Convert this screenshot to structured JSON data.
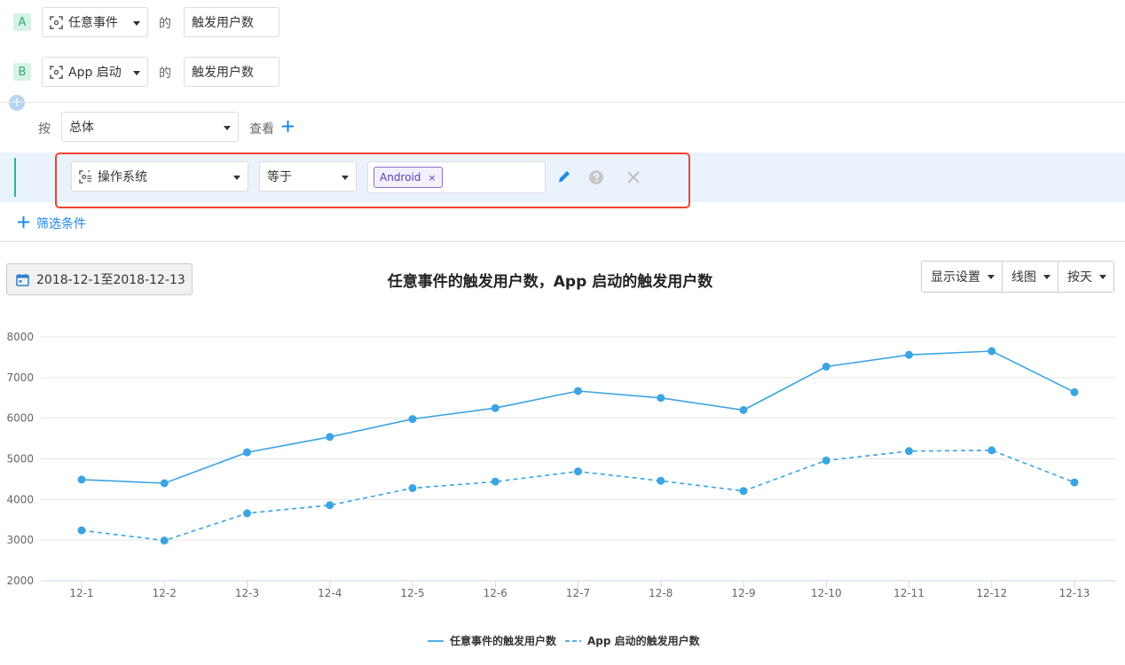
{
  "metrics": [
    {
      "badge": "A",
      "event": "任意事件",
      "of": "的",
      "measure": "触发用户数"
    },
    {
      "badge": "B",
      "event": "App 启动",
      "of": "的",
      "measure": "触发用户数"
    }
  ],
  "groupby": {
    "prefix": "按",
    "value": "总体",
    "suffix": "查看"
  },
  "filter": {
    "property": "操作系统",
    "operator": "等于",
    "value_tag": "Android",
    "tag_close": "×"
  },
  "add_filter_label": "筛选条件",
  "date_range": "2018-12-1至2018-12-13",
  "chart_title": "任意事件的触发用户数，App 启动的触发用户数",
  "toolbar": {
    "display_settings": "显示设置",
    "chart_type": "线图",
    "granularity": "按天"
  },
  "chart_data": {
    "type": "line",
    "categories": [
      "12-1",
      "12-2",
      "12-3",
      "12-4",
      "12-5",
      "12-6",
      "12-7",
      "12-8",
      "12-9",
      "12-10",
      "12-11",
      "12-12",
      "12-13"
    ],
    "ylim": [
      2000,
      8000
    ],
    "yticks": [
      "2000",
      "3000",
      "4000",
      "5000",
      "6000",
      "7000",
      "8000"
    ],
    "grid": true,
    "legend_position": "bottom-center",
    "series": [
      {
        "name": "任意事件的触发用户数",
        "style": "solid",
        "color": "#3ba4e2",
        "values": [
          4490,
          4400,
          5160,
          5540,
          5980,
          6250,
          6670,
          6500,
          6200,
          7270,
          7560,
          7650,
          6640
        ]
      },
      {
        "name": "App 启动的触发用户数",
        "style": "dashed",
        "color": "#3ba4e2",
        "values": [
          3240,
          2990,
          3660,
          3860,
          4280,
          4440,
          4690,
          4460,
          4210,
          4960,
          5190,
          5210,
          4420
        ]
      }
    ]
  },
  "colors": {
    "accent": "#1e88e5",
    "highlight_border": "#f0442f",
    "line": "#3ba4e2",
    "badge_bg": "#d6f3e6",
    "badge_text": "#2ea878"
  }
}
